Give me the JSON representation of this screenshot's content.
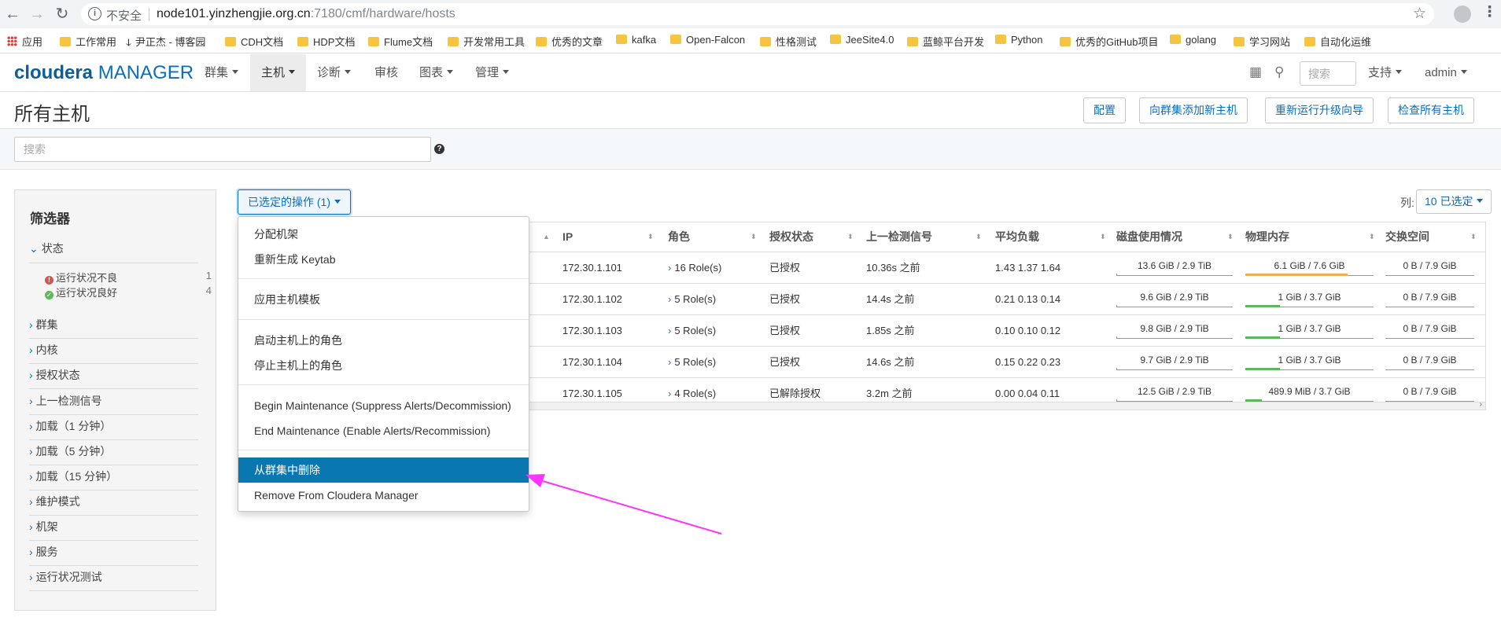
{
  "browser": {
    "insecure_label": "不安全",
    "url_host": "node101.yinzhengjie.org.cn",
    "url_rest": ":7180/cmf/hardware/hosts",
    "bookmarks": [
      "应用",
      "工作常用",
      "尹正杰 - 博客园",
      "CDH文档",
      "HDP文档",
      "Flume文档",
      "开发常用工具",
      "优秀的文章",
      "kafka",
      "Open-Falcon",
      "性格测试",
      "JeeSite4.0",
      "蓝鲸平台开发",
      "Python",
      "优秀的GitHub项目",
      "golang",
      "学习网站",
      "自动化运维"
    ]
  },
  "header": {
    "logo_c": "cloudera",
    "logo_m": "MANAGER",
    "nav": [
      "群集",
      "主机",
      "诊断",
      "审核",
      "图表",
      "管理"
    ],
    "search_placeholder": "搜索",
    "support": "支持",
    "user": "admin"
  },
  "page": {
    "title": "所有主机",
    "buttons": [
      "配置",
      "向群集添加新主机",
      "重新运行升级向导",
      "检查所有主机"
    ],
    "search_placeholder": "搜索"
  },
  "filters": {
    "title": "筛选器",
    "status_label": "状态",
    "status_items": [
      {
        "label": "运行状况不良",
        "count": "1"
      },
      {
        "label": "运行状况良好",
        "count": "4"
      }
    ],
    "groups": [
      "群集",
      "内核",
      "授权状态",
      "上一检测信号",
      "加载（1 分钟）",
      "加载（5 分钟）",
      "加载（15 分钟）",
      "维护模式",
      "机架",
      "服务",
      "运行状况测试"
    ]
  },
  "toolbar": {
    "selected_actions": "已选定的操作 (1)",
    "columns_label": "列:",
    "columns_value": "10 已选定"
  },
  "table": {
    "headers": [
      "IP",
      "角色",
      "授权状态",
      "上一检测信号",
      "平均负载",
      "磁盘使用情况",
      "物理内存",
      "交换空间"
    ],
    "rows": [
      {
        "ip": "172.30.1.101",
        "roles": "16 Role(s)",
        "auth": "已授权",
        "heartbeat": "10.36s 之前",
        "load": "1.43  1.37  1.64",
        "disk": "13.6 GiB / 2.9 TiB",
        "disk_pct": 0.5,
        "mem": "6.1 GiB / 7.6 GiB",
        "mem_pct": 80,
        "mem_color": "#f0ad4e",
        "swap": "0 B / 7.9 GiB"
      },
      {
        "ip": "172.30.1.102",
        "roles": "5 Role(s)",
        "auth": "已授权",
        "heartbeat": "14.4s 之前",
        "load": "0.21  0.13  0.14",
        "disk": "9.6 GiB / 2.9 TiB",
        "disk_pct": 0.3,
        "mem": "1 GiB / 3.7 GiB",
        "mem_pct": 27,
        "mem_color": "#5cb85c",
        "swap": "0 B / 7.9 GiB"
      },
      {
        "ip": "172.30.1.103",
        "roles": "5 Role(s)",
        "auth": "已授权",
        "heartbeat": "1.85s 之前",
        "load": "0.10  0.10  0.12",
        "disk": "9.8 GiB / 2.9 TiB",
        "disk_pct": 0.3,
        "mem": "1 GiB / 3.7 GiB",
        "mem_pct": 27,
        "mem_color": "#5cb85c",
        "swap": "0 B / 7.9 GiB"
      },
      {
        "ip": "172.30.1.104",
        "roles": "5 Role(s)",
        "auth": "已授权",
        "heartbeat": "14.6s 之前",
        "load": "0.15  0.22  0.23",
        "disk": "9.7 GiB / 2.9 TiB",
        "disk_pct": 0.3,
        "mem": "1 GiB / 3.7 GiB",
        "mem_pct": 27,
        "mem_color": "#5cb85c",
        "swap": "0 B / 7.9 GiB"
      },
      {
        "ip": "172.30.1.105",
        "roles": "4 Role(s)",
        "auth": "已解除授权",
        "heartbeat": "3.2m 之前",
        "load": "0.00  0.04  0.11",
        "disk": "12.5 GiB / 2.9 TiB",
        "disk_pct": 0.4,
        "mem": "489.9 MiB / 3.7 GiB",
        "mem_pct": 13,
        "mem_color": "#5cb85c",
        "swap": "0 B / 7.9 GiB"
      }
    ]
  },
  "menu": {
    "items": [
      "分配机架",
      "重新生成 Keytab",
      "应用主机模板",
      "启动主机上的角色",
      "停止主机上的角色",
      "Begin Maintenance (Suppress Alerts/Decommission)",
      "End Maintenance (Enable Alerts/Recommission)",
      "从群集中删除",
      "Remove From Cloudera Manager"
    ]
  },
  "colors": {
    "accent": "#0a6ebd",
    "menu_active": "#0a78b0",
    "annotation_arrow": "#ff33ff"
  }
}
